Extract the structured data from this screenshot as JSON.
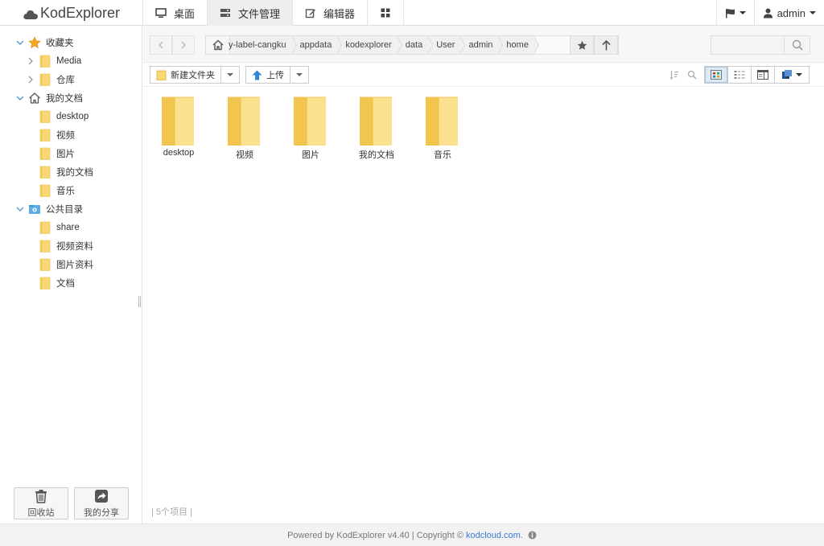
{
  "app": {
    "title": "KodExplorer"
  },
  "nav": {
    "desktop": "桌面",
    "file_manager": "文件管理",
    "editor": "编辑器"
  },
  "topright": {
    "user": "admin"
  },
  "sidebar": {
    "groups": [
      {
        "label": "收藏夹",
        "icon": "star-icon",
        "children": [
          "Media",
          "仓库"
        ]
      },
      {
        "label": "我的文档",
        "icon": "home-icon",
        "children": [
          "desktop",
          "视频",
          "图片",
          "我的文档",
          "音乐"
        ]
      },
      {
        "label": "公共目录",
        "icon": "public-folder-icon",
        "children": [
          "share",
          "视频资料",
          "图片资料",
          "文档"
        ]
      }
    ],
    "recycle": "回收站",
    "my_share": "我的分享"
  },
  "address": {
    "crumbs": [
      "y-label-cangku",
      "appdata",
      "kodexplorer",
      "data",
      "User",
      "admin",
      "home"
    ],
    "search_placeholder": ""
  },
  "toolbar": {
    "new_folder": "新建文件夹",
    "upload": "上传"
  },
  "files": [
    "desktop",
    "视频",
    "图片",
    "我的文档",
    "音乐"
  ],
  "status": {
    "count": "5个项目"
  },
  "footer": {
    "text": "Powered by KodExplorer v4.40 | Copyright ©",
    "link": "kodcloud.com",
    "dot": "."
  },
  "colors": {
    "folder": "#f8d775",
    "folder_dark": "#e9b949",
    "accent": "#3a7bd5"
  }
}
